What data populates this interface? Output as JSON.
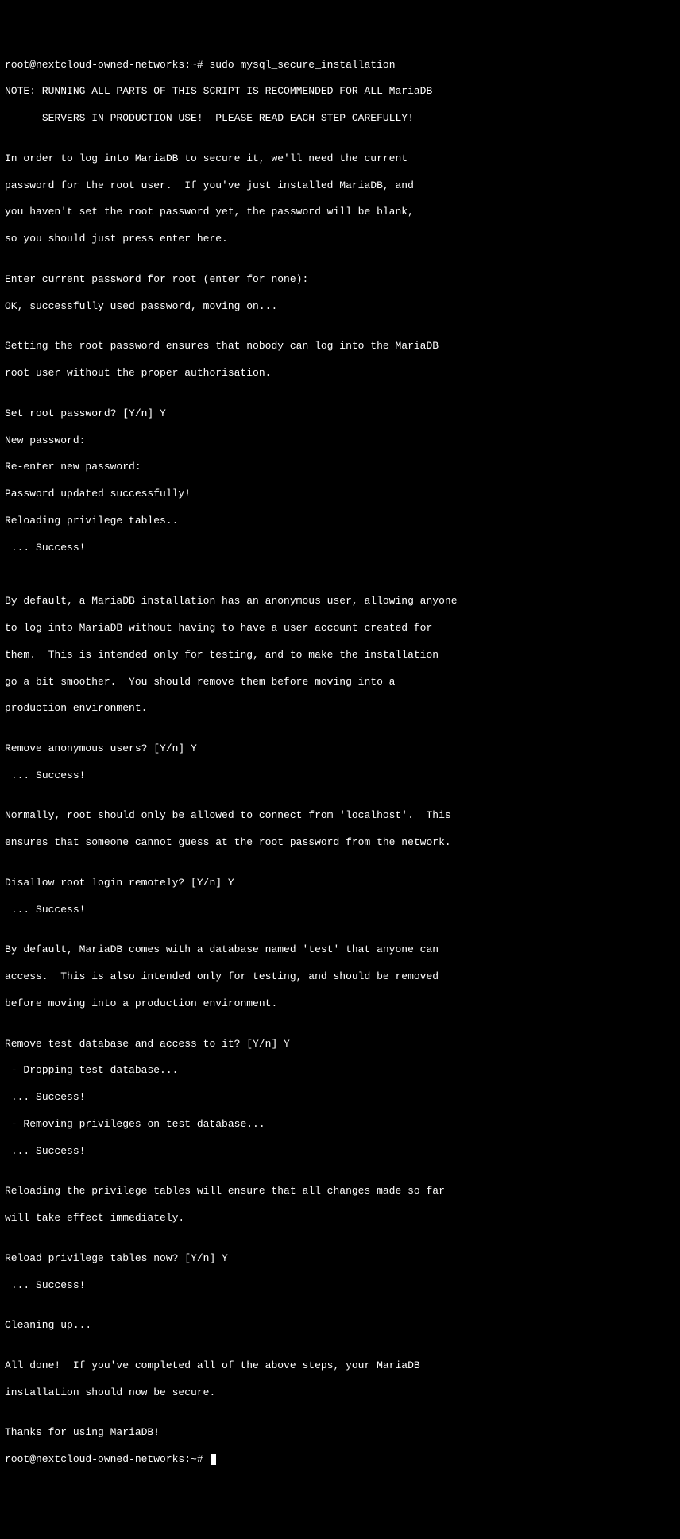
{
  "prompt1": "root@nextcloud-owned-networks:~# ",
  "command1": "sudo mysql_secure_installation",
  "lines": [
    "",
    "NOTE: RUNNING ALL PARTS OF THIS SCRIPT IS RECOMMENDED FOR ALL MariaDB",
    "      SERVERS IN PRODUCTION USE!  PLEASE READ EACH STEP CAREFULLY!",
    "",
    "In order to log into MariaDB to secure it, we'll need the current",
    "password for the root user.  If you've just installed MariaDB, and",
    "you haven't set the root password yet, the password will be blank,",
    "so you should just press enter here.",
    "",
    "Enter current password for root (enter for none):",
    "OK, successfully used password, moving on...",
    "",
    "Setting the root password ensures that nobody can log into the MariaDB",
    "root user without the proper authorisation.",
    "",
    "Set root password? [Y/n] Y",
    "New password:",
    "Re-enter new password:",
    "Password updated successfully!",
    "Reloading privilege tables..",
    " ... Success!",
    "",
    "",
    "By default, a MariaDB installation has an anonymous user, allowing anyone",
    "to log into MariaDB without having to have a user account created for",
    "them.  This is intended only for testing, and to make the installation",
    "go a bit smoother.  You should remove them before moving into a",
    "production environment.",
    "",
    "Remove anonymous users? [Y/n] Y",
    " ... Success!",
    "",
    "Normally, root should only be allowed to connect from 'localhost'.  This",
    "ensures that someone cannot guess at the root password from the network.",
    "",
    "Disallow root login remotely? [Y/n] Y",
    " ... Success!",
    "",
    "By default, MariaDB comes with a database named 'test' that anyone can",
    "access.  This is also intended only for testing, and should be removed",
    "before moving into a production environment.",
    "",
    "Remove test database and access to it? [Y/n] Y",
    " - Dropping test database...",
    " ... Success!",
    " - Removing privileges on test database...",
    " ... Success!",
    "",
    "Reloading the privilege tables will ensure that all changes made so far",
    "will take effect immediately.",
    "",
    "Reload privilege tables now? [Y/n] Y",
    " ... Success!",
    "",
    "Cleaning up...",
    "",
    "All done!  If you've completed all of the above steps, your MariaDB",
    "installation should now be secure.",
    "",
    "Thanks for using MariaDB!"
  ],
  "prompt2": "root@nextcloud-owned-networks:~# "
}
